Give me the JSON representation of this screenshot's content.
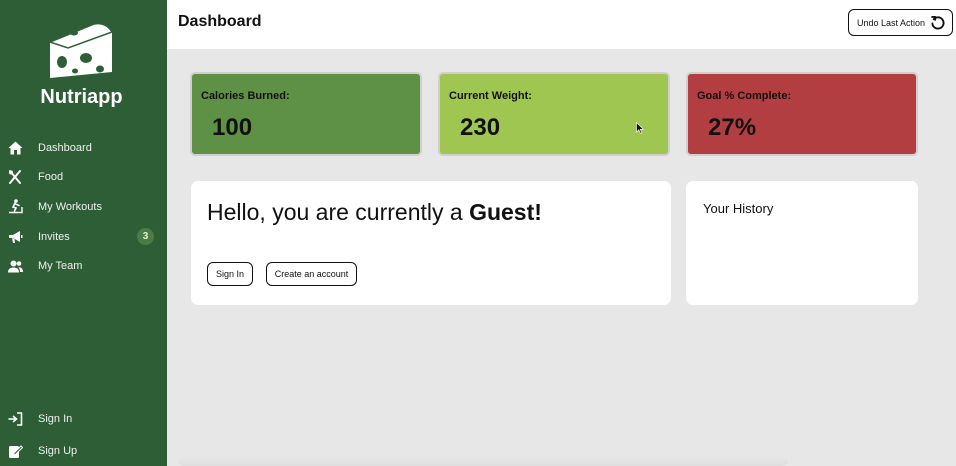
{
  "app": {
    "name": "Nutriapp"
  },
  "sidebar": {
    "items": [
      {
        "label": "Dashboard",
        "icon": "home-icon"
      },
      {
        "label": "Food",
        "icon": "utensils-icon"
      },
      {
        "label": "My Workouts",
        "icon": "treadmill-icon"
      },
      {
        "label": "Invites",
        "icon": "megaphone-icon",
        "badge": "3"
      },
      {
        "label": "My Team",
        "icon": "users-icon"
      }
    ],
    "bottom_items": [
      {
        "label": "Sign In",
        "icon": "sign-in-icon"
      },
      {
        "label": "Sign Up",
        "icon": "sign-up-icon"
      }
    ]
  },
  "header": {
    "title": "Dashboard",
    "undo_label": "Undo Last Action",
    "undo_icon": "undo-icon"
  },
  "stats": [
    {
      "label": "Calories Burned:",
      "value": "100",
      "color": "#5e9145"
    },
    {
      "label": "Current Weight:",
      "value": "230",
      "color": "#9fc650"
    },
    {
      "label": "Goal % Complete:",
      "value": "27%",
      "color": "#b33e42"
    }
  ],
  "greeting": {
    "prefix": "Hello, you are currently a ",
    "role": "Guest!",
    "sign_in_label": "Sign In",
    "create_account_label": "Create an account"
  },
  "history": {
    "title": "Your History"
  },
  "colors": {
    "sidebar": "#2e5e36",
    "background": "#e7e7e7",
    "badge": "#4b7c48"
  }
}
